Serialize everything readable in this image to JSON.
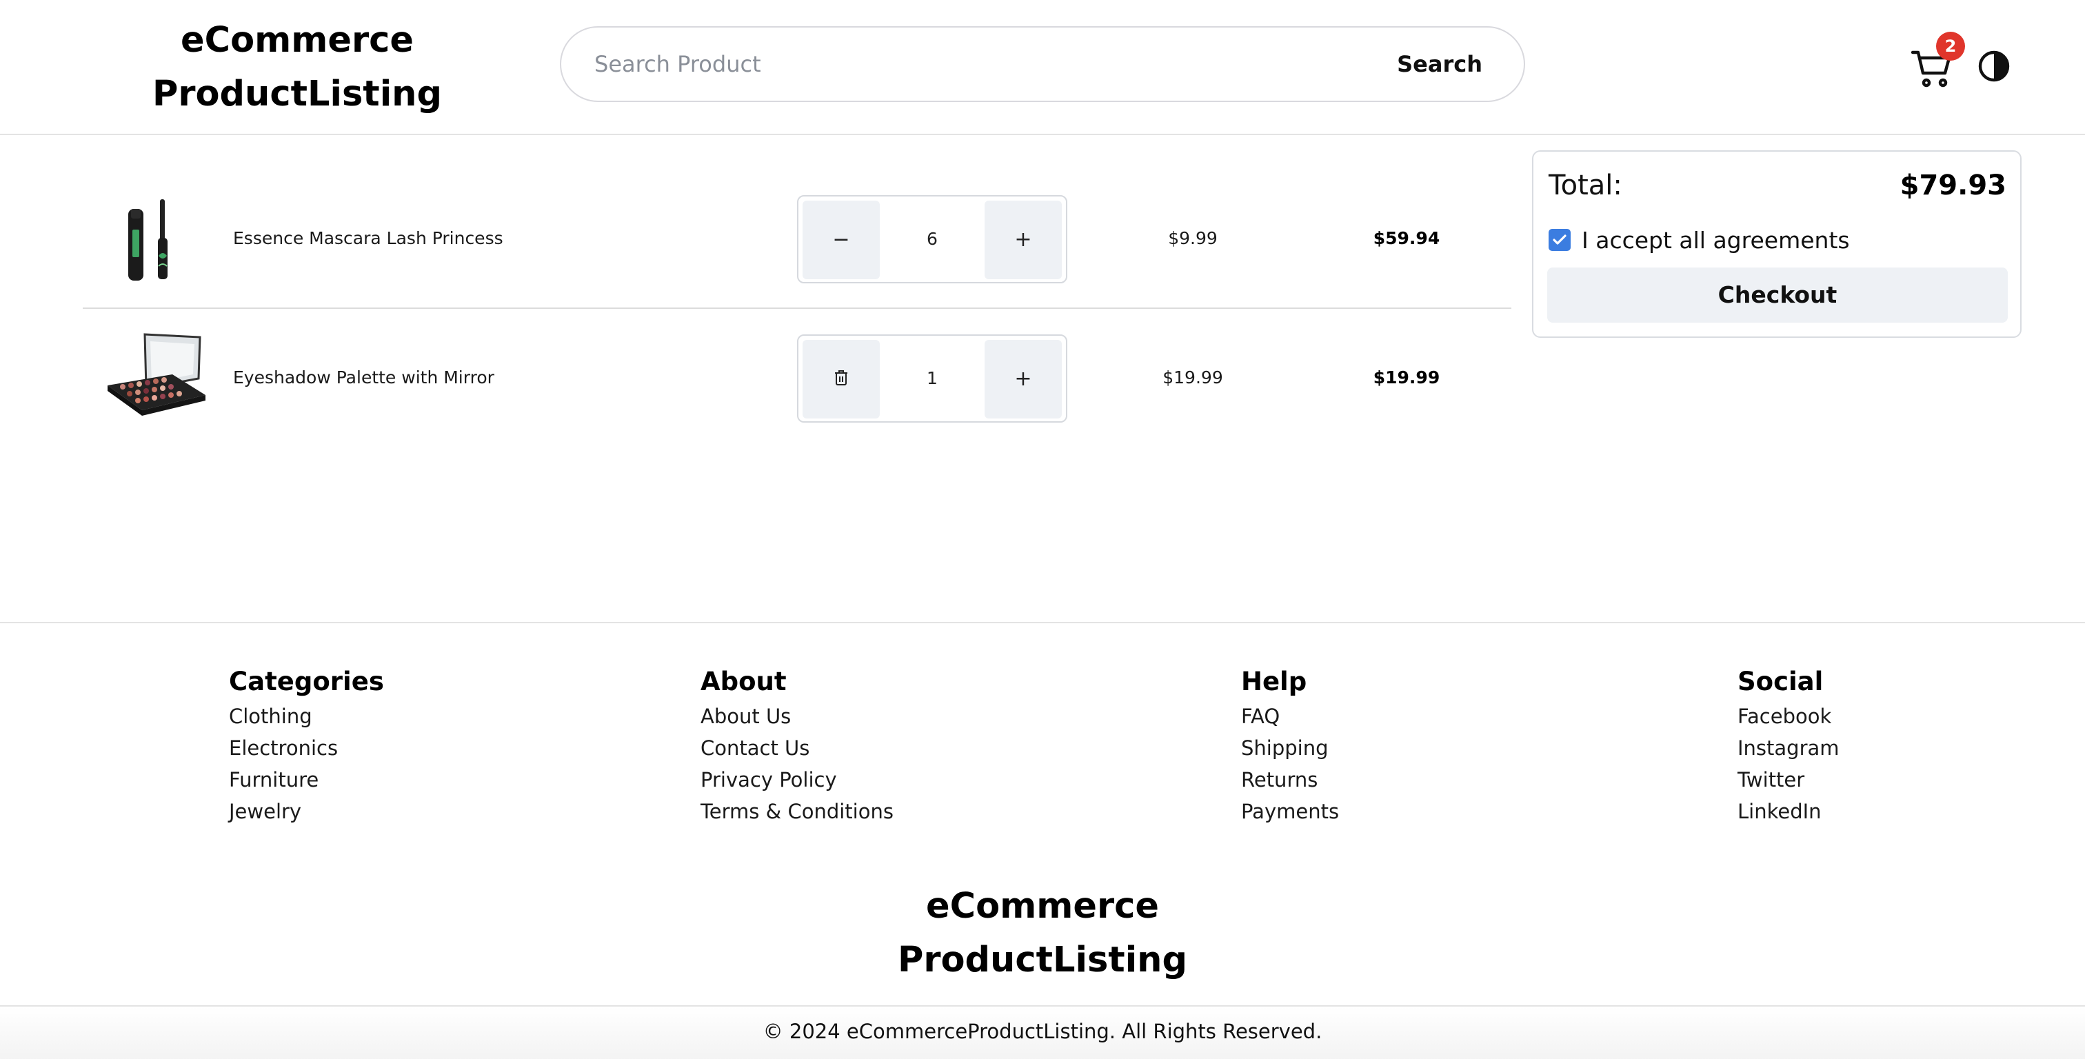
{
  "header": {
    "brand": "eCommerce ProductListing",
    "search_placeholder": "Search Product",
    "search_button": "Search",
    "cart_count": "2"
  },
  "cart": {
    "items": [
      {
        "name": "Essence Mascara Lash Princess",
        "quantity": "6",
        "decrement_symbol": "−",
        "increment_symbol": "+",
        "unit_price": "$9.99",
        "line_total": "$59.94"
      },
      {
        "name": "Eyeshadow Palette with Mirror",
        "quantity": "1",
        "decrement_icon": "trash-icon",
        "increment_symbol": "+",
        "unit_price": "$19.99",
        "line_total": "$19.99"
      }
    ]
  },
  "summary": {
    "total_label": "Total:",
    "total_value": "$79.93",
    "agreement_label": "I accept all agreements",
    "agreement_checked": true,
    "checkout_label": "Checkout"
  },
  "footer": {
    "columns": [
      {
        "title": "Categories",
        "links": [
          "Clothing",
          "Electronics",
          "Furniture",
          "Jewelry"
        ]
      },
      {
        "title": "About",
        "links": [
          "About Us",
          "Contact Us",
          "Privacy Policy",
          "Terms & Conditions"
        ]
      },
      {
        "title": "Help",
        "links": [
          "FAQ",
          "Shipping",
          "Returns",
          "Payments"
        ]
      },
      {
        "title": "Social",
        "links": [
          "Facebook",
          "Instagram",
          "Twitter",
          "LinkedIn"
        ]
      }
    ],
    "brand": "eCommerce ProductListing",
    "copyright": "© 2024 eCommerceProductListing. All Rights Reserved."
  },
  "colors": {
    "badge": "#e0352b",
    "checkbox": "#3b7de0",
    "button_bg": "#eef1f5"
  }
}
